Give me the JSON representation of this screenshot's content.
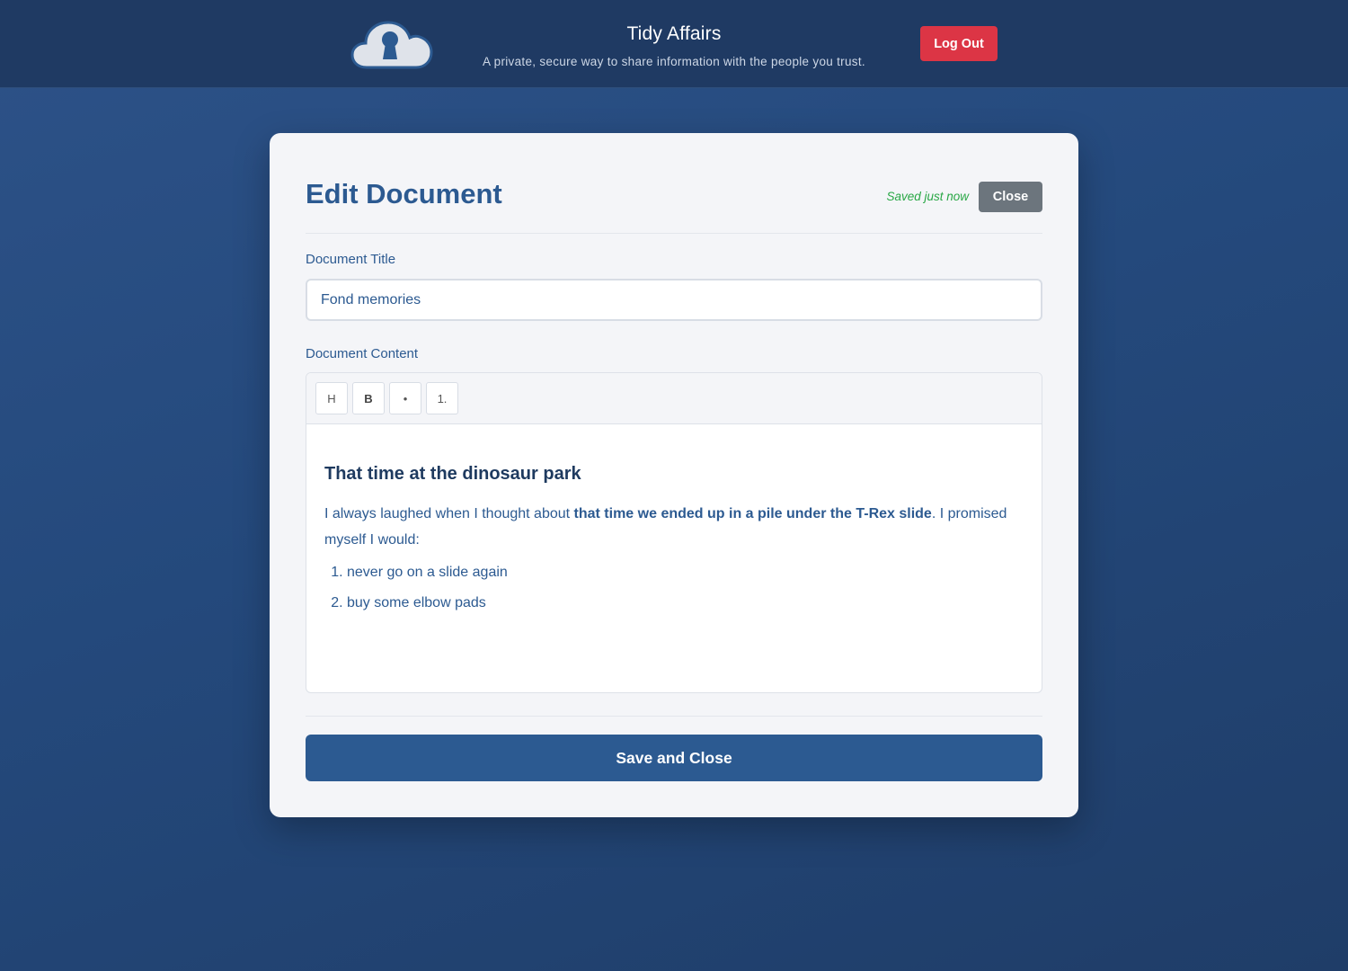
{
  "header": {
    "app_title": "Tidy Affairs",
    "tagline": "A private, secure way to share information with the people you trust.",
    "logout_label": "Log Out",
    "logo_icon": "cloud-keyhole-icon"
  },
  "editor_page": {
    "title": "Edit Document",
    "saved_status": "Saved just now",
    "close_label": "Close",
    "title_field_label": "Document Title",
    "title_value": "Fond memories",
    "content_field_label": "Document Content",
    "toolbar": {
      "heading_label": "H",
      "bold_label": "B",
      "bullet_label": "•",
      "numbered_label": "1."
    },
    "content": {
      "heading": "That time at the dinosaur park",
      "para_before": "I always laughed when I thought about ",
      "para_bold": "that time we ended up in a pile under the T-Rex slide",
      "para_after": ". I promised myself I would:",
      "list": [
        "never go on a slide again",
        "buy some elbow pads"
      ]
    },
    "save_label": "Save and Close"
  },
  "colors": {
    "primary": "#2c5a91",
    "header_bg": "#1f3a63",
    "danger": "#dc3545",
    "secondary": "#6c757d",
    "success": "#28a745"
  }
}
